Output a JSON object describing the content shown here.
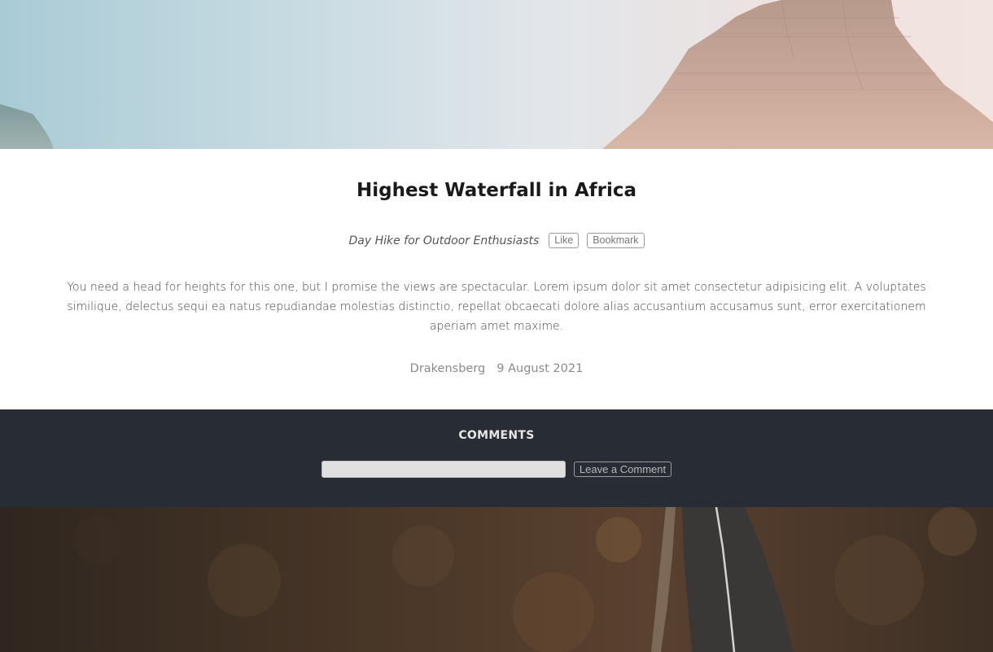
{
  "hero": {
    "alt": "Mountain peak under a pastel sky"
  },
  "post": {
    "title": "Highest Waterfall in Africa",
    "subtitle": "Day Hike for Outdoor Enthusiasts",
    "like_label": "Like",
    "bookmark_label": "Bookmark",
    "body": "You need a head for heights for this one, but I promise the views are spectacular. Lorem ipsum dolor sit amet consectetur adipisicing elit. A voluptates similique, delectus sequi ea natus repudiandae molestias distinctio, repellat obcaecati dolore alias accusantium accusamus sunt, error exercitationem aperiam amet maxime.",
    "location": "Drakensberg",
    "date": "9 August 2021"
  },
  "comments": {
    "title": "COMMENTS",
    "input_value": "",
    "input_placeholder": "",
    "submit_label": "Leave a Comment"
  },
  "footer_image": {
    "alt": "Aerial view of a road through brush"
  },
  "colors": {
    "comments_bg": "#282d35",
    "page_bg": "#ffffff",
    "title": "#1a1a1a",
    "muted": "#8a8a8a"
  }
}
